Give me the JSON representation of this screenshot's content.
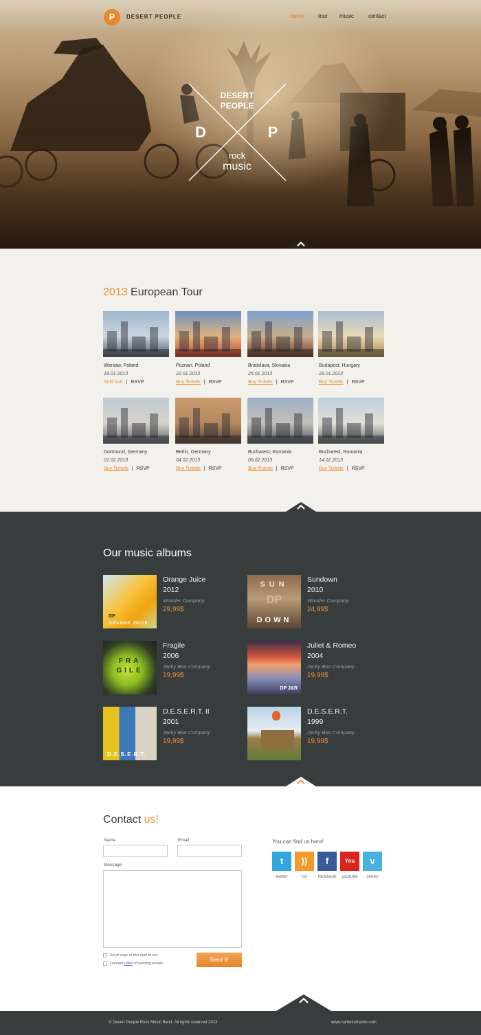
{
  "header": {
    "logo_letter": "P",
    "brand": "DESERT PEOPLE",
    "nav": [
      "home",
      "tour",
      "music",
      "contact"
    ],
    "accent": "#e07b22"
  },
  "hero": {
    "emblem_line1": "DESERT",
    "emblem_line2": "PEOPLE",
    "emblem_left": "D",
    "emblem_right": "P",
    "emblem_rock": "rock",
    "emblem_music": "music"
  },
  "tour": {
    "title_year": "2013",
    "title_rest": " European Tour",
    "rsvp_label": "RSVP",
    "cards": [
      {
        "city": "Warsaw, Poland",
        "date": "18.01.2013",
        "action": "Sold out!"
      },
      {
        "city": "Poznan, Poland",
        "date": "22.01.2013",
        "action": "Buy Tickets"
      },
      {
        "city": "Bratislava, Slovakia",
        "date": "25.01.2013",
        "action": "Buy Tickets"
      },
      {
        "city": "Budapest, Hungary",
        "date": "29.01.2013",
        "action": "Buy Tickets"
      },
      {
        "city": "Dortmund, Germany",
        "date": "01.02.2013",
        "action": "Buy Tickets"
      },
      {
        "city": "Berlin, Germany",
        "date": "04.02.2013",
        "action": "Buy Tickets"
      },
      {
        "city": "Bucharest, Romania",
        "date": "06.02.2013",
        "action": "Buy Tickets"
      },
      {
        "city": "Bucharest, Romania",
        "date": "14.02.2013",
        "action": "Buy Tickets"
      }
    ]
  },
  "albums": {
    "title": "Our music albums",
    "items": [
      {
        "title": "Orange Juice",
        "year": "2012",
        "company": "Wonder Company",
        "price": "29,99$",
        "cover_text": "DP",
        "cover_sub": "ORANGE JUICE"
      },
      {
        "title": "Sundown",
        "year": "2010",
        "company": "Wonder Company",
        "price": "24,99$",
        "cover_text": "SUN",
        "cover_sub": "DOWN",
        "cover_mid": "DP"
      },
      {
        "title": "Fragile",
        "year": "2006",
        "company": "Jacky Boo Company",
        "price": "19,99$",
        "cover_text": "FRA",
        "cover_sub": "GILE"
      },
      {
        "title": "Juliet & Romeo",
        "year": "2004",
        "company": "Jacky Boo Company",
        "price": "19,99$",
        "cover_text": "DP J&R"
      },
      {
        "title": "D.E.S.E.R.T. II",
        "year": "2001",
        "company": "Jacky Boo Company",
        "price": "19,99$",
        "cover_text": "D.E.S.E.R.T."
      },
      {
        "title": "D.E.S.E.R.T.",
        "year": "1999",
        "company": "Jacky Boo Company",
        "price": "19,99$"
      }
    ]
  },
  "contact": {
    "title_main": "Contact ",
    "title_accent": "us!",
    "name_label": "Name",
    "email_label": "Email",
    "message_label": "Message",
    "copy_label": "Send copy of this mail to me",
    "accept_prefix": "I accept ",
    "accept_link": "rules",
    "accept_suffix": " of sending emails..",
    "send_label": "Send it!",
    "find_us": "You can find us here!",
    "social": [
      {
        "label": "twitter",
        "icon": "twitter-icon",
        "color": "#2fa6dc"
      },
      {
        "label": "rss",
        "icon": "rss-icon",
        "color": "#f39a2a"
      },
      {
        "label": "facebook",
        "icon": "facebook-icon",
        "color": "#3a5a98"
      },
      {
        "label": "youtube",
        "icon": "youtube-icon",
        "color": "#d8231f"
      },
      {
        "label": "vimeo",
        "icon": "vimeo-icon",
        "color": "#48b1e0"
      }
    ]
  },
  "footer": {
    "copyright": "© Desert People Rock Music Band. All rights reserved 2013",
    "site": "www.namesurname.com"
  }
}
